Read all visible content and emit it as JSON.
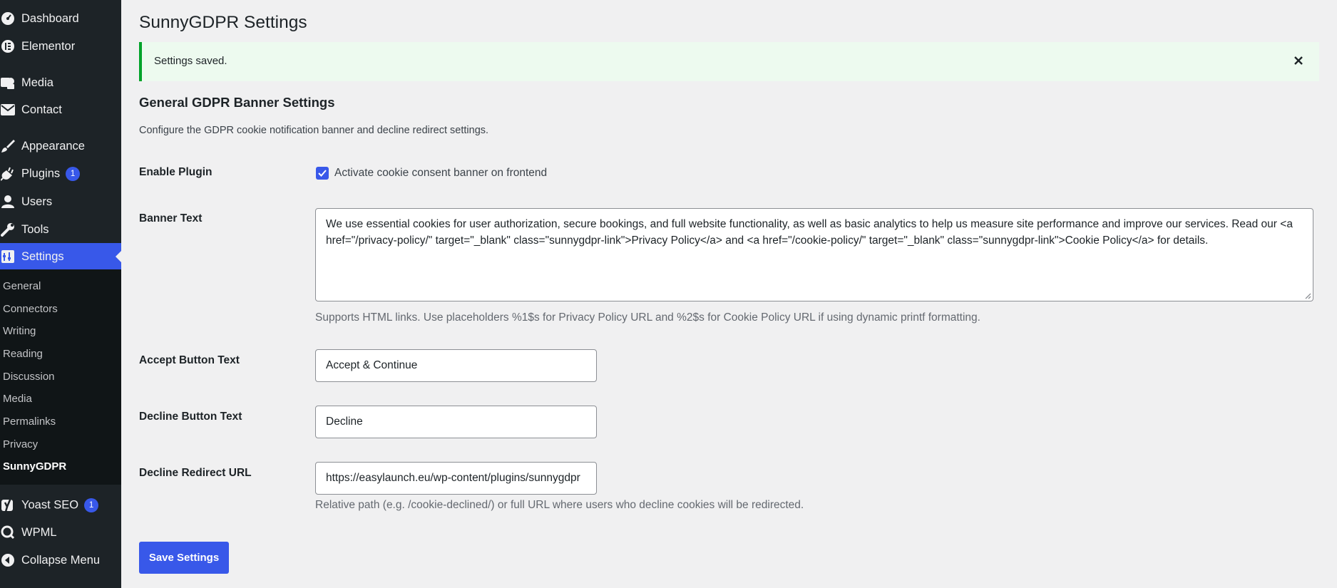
{
  "sidebar": {
    "items": [
      {
        "label": "Dashboard",
        "icon": "dashboard-icon"
      },
      {
        "label": "Elementor",
        "icon": "elementor-icon"
      },
      {
        "label": "Media",
        "icon": "media-icon"
      },
      {
        "label": "Contact",
        "icon": "mail-icon"
      },
      {
        "label": "Appearance",
        "icon": "paintbrush-icon"
      },
      {
        "label": "Plugins",
        "icon": "plugins-icon",
        "badge": "1"
      },
      {
        "label": "Users",
        "icon": "users-icon"
      },
      {
        "label": "Tools",
        "icon": "wrench-icon"
      },
      {
        "label": "Settings",
        "icon": "settings-icon",
        "current": true
      },
      {
        "label": "Yoast SEO",
        "icon": "yoast-icon",
        "badge": "1"
      },
      {
        "label": "WPML",
        "icon": "wpml-icon"
      },
      {
        "label": "Collapse Menu",
        "icon": "collapse-icon"
      }
    ],
    "submenu": [
      "General",
      "Connectors",
      "Writing",
      "Reading",
      "Discussion",
      "Media",
      "Permalinks",
      "Privacy",
      "SunnyGDPR"
    ],
    "active_submenu": "SunnyGDPR"
  },
  "page": {
    "title": "SunnyGDPR Settings",
    "notice": "Settings saved.",
    "section_title": "General GDPR Banner Settings",
    "section_desc": "Configure the GDPR cookie notification banner and decline redirect settings."
  },
  "form": {
    "enable_label": "Enable Plugin",
    "enable_checkbox_text": "Activate cookie consent banner on frontend",
    "enable_checked": true,
    "banner_label": "Banner Text",
    "banner_value": "We use essential cookies for user authorization, secure bookings, and full website functionality, as well as basic analytics to help us measure site performance and improve our services. Read our <a href=\"/privacy-policy/\" target=\"_blank\" class=\"sunnygdpr-link\">Privacy Policy</a> and <a href=\"/cookie-policy/\" target=\"_blank\" class=\"sunnygdpr-link\">Cookie Policy</a> for details.",
    "banner_help": "Supports HTML links. Use placeholders %1$s for Privacy Policy URL and %2$s for Cookie Policy URL if using dynamic printf formatting.",
    "accept_label": "Accept Button Text",
    "accept_value": "Accept & Continue",
    "decline_label": "Decline Button Text",
    "decline_value": "Decline",
    "redirect_label": "Decline Redirect URL",
    "redirect_value": "https://easylaunch.eu/wp-content/plugins/sunnygdpr",
    "redirect_help": "Relative path (e.g. /cookie-declined/) or full URL where users who decline cookies will be redirected.",
    "save_label": "Save Settings"
  },
  "colors": {
    "sidebar_bg": "#1d2327",
    "submenu_bg": "#101517",
    "accent": "#3858e9",
    "notice_border": "#00a32a",
    "notice_bg": "#edfaef"
  }
}
